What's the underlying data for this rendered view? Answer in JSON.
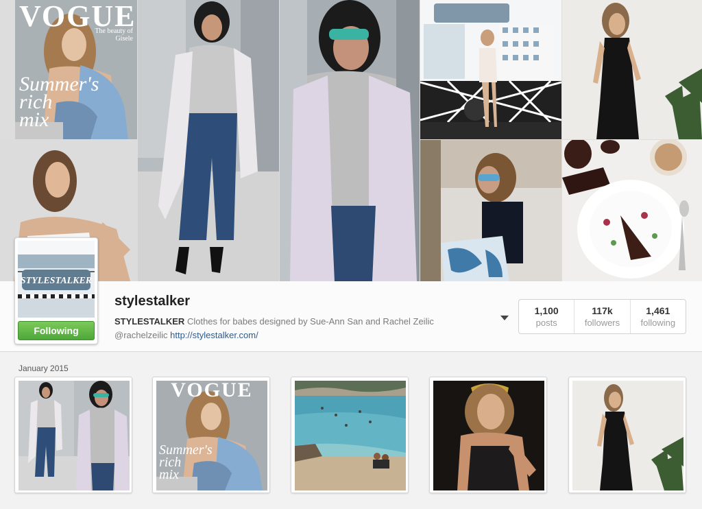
{
  "cover": {
    "magazine_title": "VOGUE",
    "magazine_cover_line": "Summer's rich mix",
    "magazine_side_text": "The beauty of Gisele"
  },
  "profile": {
    "avatar_caption": "STYLESTALKER",
    "follow_label": "Following",
    "username": "stylestalker",
    "display_name": "STYLESTALKER",
    "bio_text": "Clothes for babes designed by Sue-Ann San and Rachel Zeilic",
    "bio_handle": "@rachelzeilic",
    "bio_link": "http://stylestalker.com/",
    "stats": [
      {
        "value": "1,100",
        "label": "posts"
      },
      {
        "value": "117k",
        "label": "followers"
      },
      {
        "value": "1,461",
        "label": "following"
      }
    ]
  },
  "feed": {
    "month_label": "January 2015",
    "thumb_magazine_title": "VOGUE",
    "thumb_cover_line": "Summer's rich mix"
  },
  "colors": {
    "follow_green": "#5bb343",
    "link_blue": "#2f5a8c"
  }
}
